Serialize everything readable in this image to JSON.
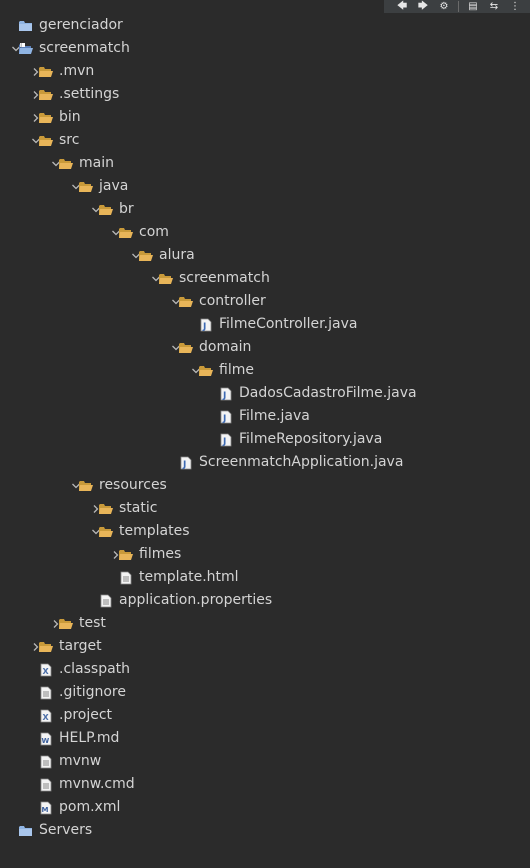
{
  "toolbar": {
    "buttons": [
      {
        "name": "back-icon",
        "glyph": "🡄"
      },
      {
        "name": "forward-icon",
        "glyph": "🡆"
      },
      {
        "name": "filter-icon",
        "glyph": "⚙"
      },
      {
        "name": "collapse-all-icon",
        "glyph": "▤"
      },
      {
        "name": "link-with-editor-icon",
        "glyph": "⇆"
      },
      {
        "name": "view-menu-icon",
        "glyph": "⋮"
      }
    ]
  },
  "tree": [
    {
      "label": "gerenciador",
      "depth": 0,
      "arrow": "none",
      "icon": "project-closed"
    },
    {
      "label": "screenmatch",
      "depth": 0,
      "arrow": "expanded",
      "icon": "project-open"
    },
    {
      "label": ".mvn",
      "depth": 1,
      "arrow": "collapsed",
      "icon": "folder"
    },
    {
      "label": ".settings",
      "depth": 1,
      "arrow": "collapsed",
      "icon": "folder"
    },
    {
      "label": "bin",
      "depth": 1,
      "arrow": "collapsed",
      "icon": "folder"
    },
    {
      "label": "src",
      "depth": 1,
      "arrow": "expanded",
      "icon": "folder"
    },
    {
      "label": "main",
      "depth": 2,
      "arrow": "expanded",
      "icon": "folder"
    },
    {
      "label": "java",
      "depth": 3,
      "arrow": "expanded",
      "icon": "folder"
    },
    {
      "label": "br",
      "depth": 4,
      "arrow": "expanded",
      "icon": "folder"
    },
    {
      "label": "com",
      "depth": 5,
      "arrow": "expanded",
      "icon": "folder"
    },
    {
      "label": "alura",
      "depth": 6,
      "arrow": "expanded",
      "icon": "folder"
    },
    {
      "label": "screenmatch",
      "depth": 7,
      "arrow": "expanded",
      "icon": "folder"
    },
    {
      "label": "controller",
      "depth": 8,
      "arrow": "expanded",
      "icon": "folder"
    },
    {
      "label": "FilmeController.java",
      "depth": 9,
      "arrow": "none",
      "icon": "java"
    },
    {
      "label": "domain",
      "depth": 8,
      "arrow": "expanded",
      "icon": "folder"
    },
    {
      "label": "filme",
      "depth": 9,
      "arrow": "expanded",
      "icon": "folder"
    },
    {
      "label": "DadosCadastroFilme.java",
      "depth": 10,
      "arrow": "none",
      "icon": "java"
    },
    {
      "label": "Filme.java",
      "depth": 10,
      "arrow": "none",
      "icon": "java"
    },
    {
      "label": "FilmeRepository.java",
      "depth": 10,
      "arrow": "none",
      "icon": "java"
    },
    {
      "label": "ScreenmatchApplication.java",
      "depth": 8,
      "arrow": "none",
      "icon": "java"
    },
    {
      "label": "resources",
      "depth": 3,
      "arrow": "expanded",
      "icon": "folder"
    },
    {
      "label": "static",
      "depth": 4,
      "arrow": "collapsed",
      "icon": "folder"
    },
    {
      "label": "templates",
      "depth": 4,
      "arrow": "expanded",
      "icon": "folder"
    },
    {
      "label": "filmes",
      "depth": 5,
      "arrow": "collapsed",
      "icon": "folder"
    },
    {
      "label": "template.html",
      "depth": 5,
      "arrow": "none",
      "icon": "text"
    },
    {
      "label": "application.properties",
      "depth": 4,
      "arrow": "none",
      "icon": "text"
    },
    {
      "label": "test",
      "depth": 2,
      "arrow": "collapsed",
      "icon": "folder"
    },
    {
      "label": "target",
      "depth": 1,
      "arrow": "collapsed",
      "icon": "folder"
    },
    {
      "label": ".classpath",
      "depth": 1,
      "arrow": "none",
      "icon": "xml"
    },
    {
      "label": ".gitignore",
      "depth": 1,
      "arrow": "none",
      "icon": "text"
    },
    {
      "label": ".project",
      "depth": 1,
      "arrow": "none",
      "icon": "xml"
    },
    {
      "label": "HELP.md",
      "depth": 1,
      "arrow": "none",
      "icon": "wiki"
    },
    {
      "label": "mvnw",
      "depth": 1,
      "arrow": "none",
      "icon": "text"
    },
    {
      "label": "mvnw.cmd",
      "depth": 1,
      "arrow": "none",
      "icon": "text"
    },
    {
      "label": "pom.xml",
      "depth": 1,
      "arrow": "none",
      "icon": "maven"
    },
    {
      "label": "Servers",
      "depth": 0,
      "arrow": "none",
      "icon": "project-closed"
    }
  ],
  "colors": {
    "background": "#2b2b2b",
    "text": "#d4d4d4",
    "folder": "#e8b559",
    "folder_dark": "#c99a3a",
    "java": "#3d6ab3",
    "arrow": "#b8b8b8",
    "project": "#8fb4e3"
  }
}
